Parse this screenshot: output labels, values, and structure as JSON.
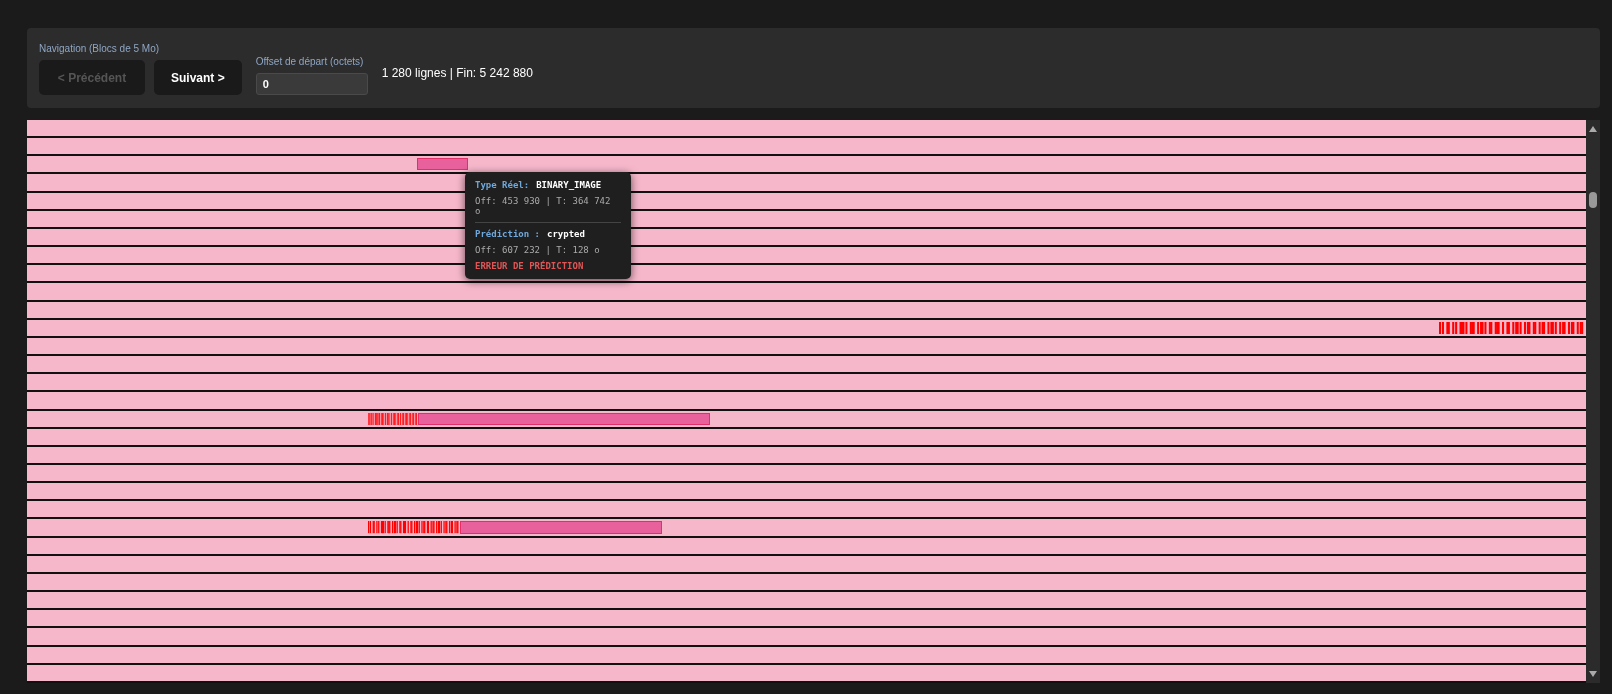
{
  "navigation": {
    "label": "Navigation (Blocs de 5 Mo)",
    "buttons": [
      {
        "label": "< Précédent",
        "disabled": true
      },
      {
        "label": "Suivant >",
        "disabled": false
      }
    ]
  },
  "offset_field": {
    "label": "Offset de départ (octets)",
    "value": "0"
  },
  "summary": "1 280 lignes | Fin: 5 242 880",
  "tooltip": {
    "actual": {
      "label": "Type Réel:",
      "value": "BINARY_IMAGE",
      "detail": "Off: 453 930 | T: 364 742 o"
    },
    "prediction": {
      "label": "Prédiction :",
      "value": "crypted",
      "detail": "Off: 607 232 | T: 128 o"
    },
    "status": "ERREUR DE PRÉDICTION"
  }
}
